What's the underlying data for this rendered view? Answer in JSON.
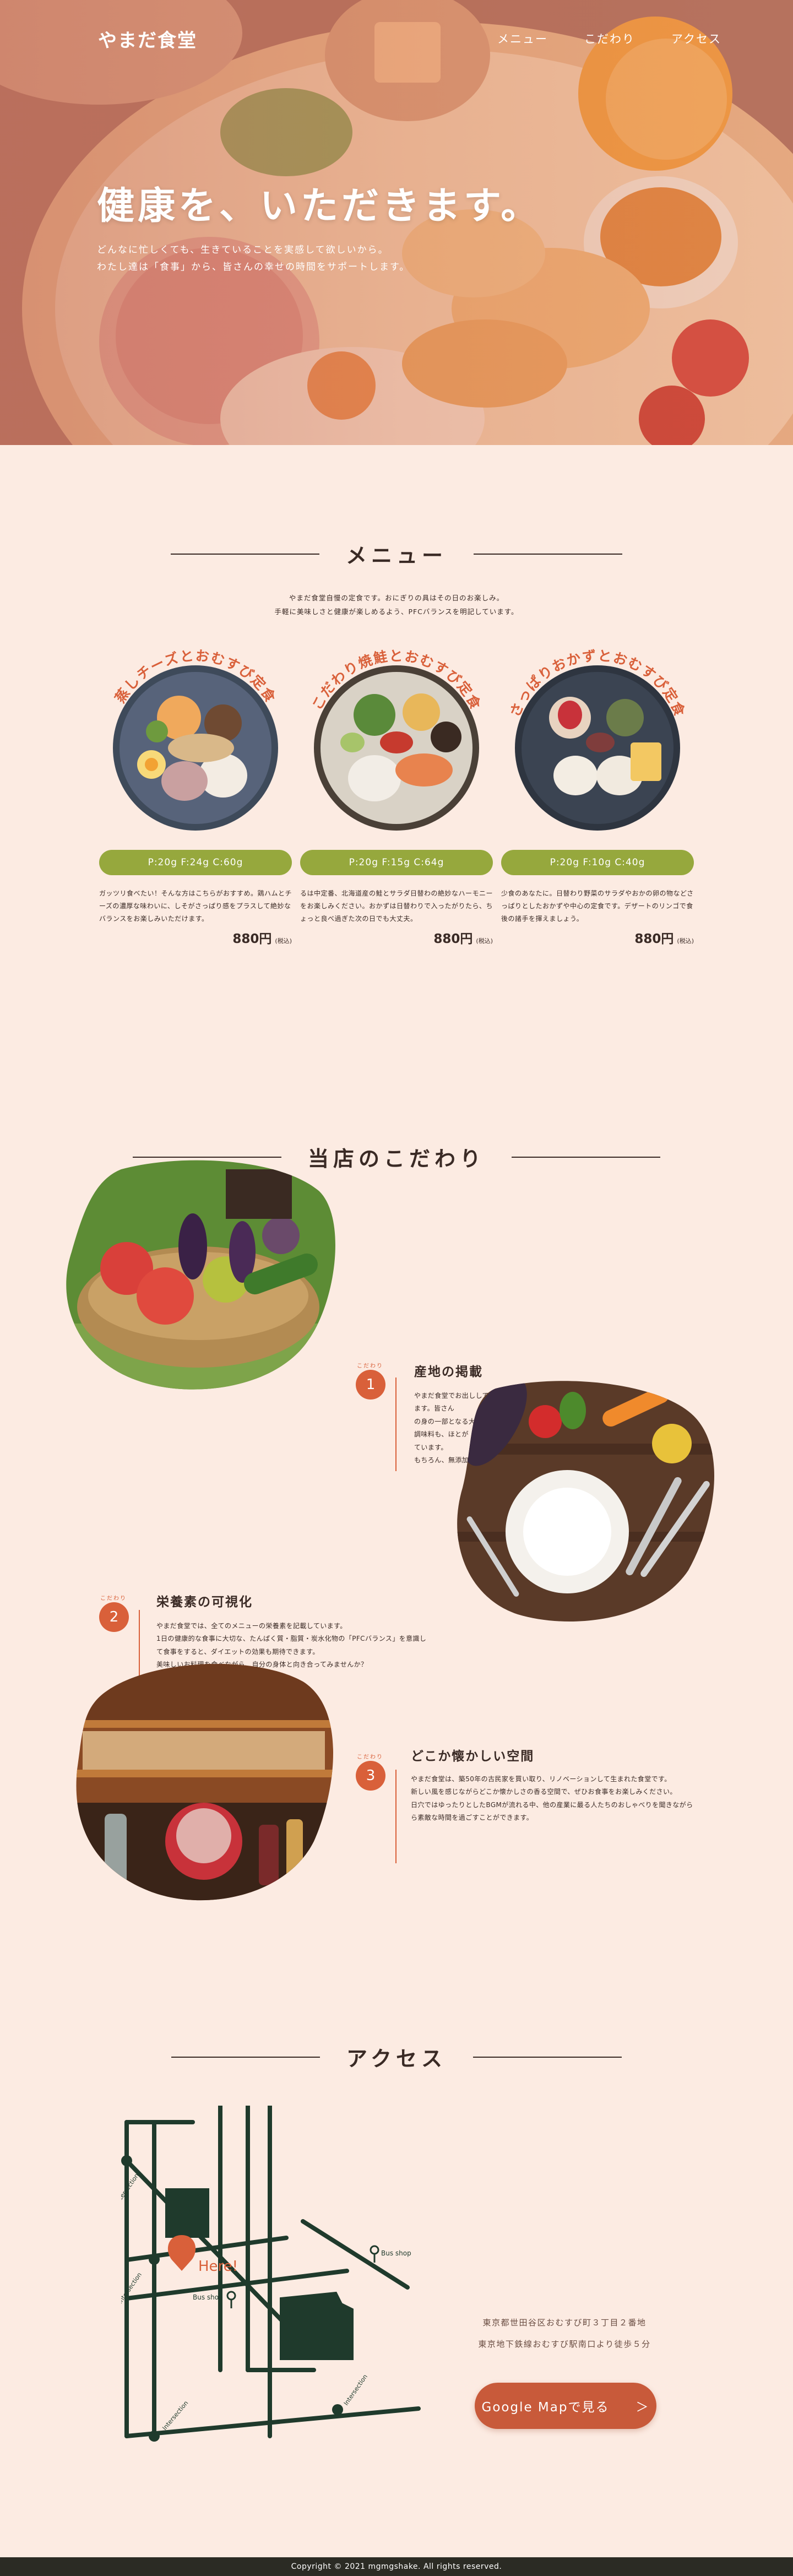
{
  "header": {
    "logo": "やまだ食堂",
    "nav": [
      "メニュー",
      "こだわり",
      "アクセス"
    ]
  },
  "hero": {
    "title": "健康を、いただきます。",
    "subtitle_lines": [
      "どんなに忙しくても、生きていることを実感して欲しいから。",
      "わたし達は「食事」から、皆さんの幸せの時間をサポートします。"
    ]
  },
  "menu": {
    "title": "メニュー",
    "lead_lines": [
      "やまだ食堂自慢の定食です。おにぎりの具はその日のお楽しみ。",
      "手軽に美味しさと健康が楽しめるよう、PFCバランスを明記しています。"
    ],
    "items": [
      {
        "name": "蒸しチーズとおむすび定食",
        "nutrition": "P:20g F:24g C:60g",
        "desc": "ガッツリ食べたい！そんな方はこちらがおすすめ。鶏ハムとチーズの濃厚な味わいに、しそがさっぱり感をプラスして絶妙なバランスをお楽しみいただけます。",
        "price": "880円",
        "tax": "(税込)"
      },
      {
        "name": "こだわり焼鮭とおむすび定食",
        "nutrition": "P:20g F:15g C:64g",
        "desc": "るは中定番、北海道産の鮭とサラダ日替わの絶妙なハーモニーをお楽しみください。おかずは日替わりで入ったがりたら、ちょっと良べ過ぎた次の日でも大丈夫。",
        "price": "880円",
        "tax": "(税込)"
      },
      {
        "name": "さっぱりおかずとおむすび定食",
        "nutrition": "P:20g F:10g C:40g",
        "desc": "少食のあなたに。日替わり野菜のサラダやおかの卵の物などさっぱりとしたおかずや中心の定食です。デザートのリンゴで食後の諸手を揮えましょう。",
        "price": "880円",
        "tax": "(税込)"
      }
    ]
  },
  "kodawari": {
    "title": "当店のこだわり",
    "kicker": "こだわり",
    "features": [
      {
        "num": "1",
        "heading": "産地の掲載",
        "text_lines": [
          "やまだ食堂でお出ししてるお料理の材料は全て、契約農家から直接仕入れています。皆さん",
          "の身の一部となる大切なお料理なので、材料の品質には妥協しません。",
          "調味料も、ほとが「これだ！」と決めたものを日本全国から取り寄せて使用しています。",
          "もちろん、無添加&化学調味料不使用です。"
        ]
      },
      {
        "num": "2",
        "heading": "栄養素の可視化",
        "text_lines": [
          "やまだ食堂では、全てのメニューの栄養素を記載しています。",
          "1日の健康的な食事に大切な、たんぱく質・脂質・炭水化物の「PFCバランス」を意識し",
          "て食事をすると、ダイエットの効果も期待できます。",
          "美味しいお料理を食べながら、自分の身体と向き合ってみませんか？"
        ]
      },
      {
        "num": "3",
        "heading": "どこか懐かしい空間",
        "text_lines": [
          "やまだ食堂は、築50年の古民家を買い取り、リノベーションして生まれた食堂です。",
          "新しい風を感じながらどこか懐かしさの香る空間で、ぜひお食事をお楽しみください。",
          "日穴ではゆったりとしたBGMが流れる中、他の産業に最る人たちのおしゃべりを聞きながら",
          "ら素敵な時間を過ごすことができます。"
        ]
      }
    ]
  },
  "access": {
    "title": "アクセス",
    "address_lines": [
      "東京都世田谷区おむすび町３丁目２番地",
      "東京地下鉄線おむすび駅南口より徒歩５分"
    ],
    "button_label": "Google Mapで見る",
    "button_arrow": "＞",
    "map_labels": {
      "here": "Here!",
      "bus_shop_1": "Bus shop",
      "bus_shop_2": "Bus shop",
      "intersection": "Intersection"
    }
  },
  "footer": {
    "copyright": "Copyright © 2021 mgmgshake. All rights reserved."
  },
  "colors": {
    "accent": "#d9603a",
    "button": "#c85a3a",
    "green": "#96a83d",
    "background": "#fcebe2",
    "footer": "#2b2b24"
  }
}
